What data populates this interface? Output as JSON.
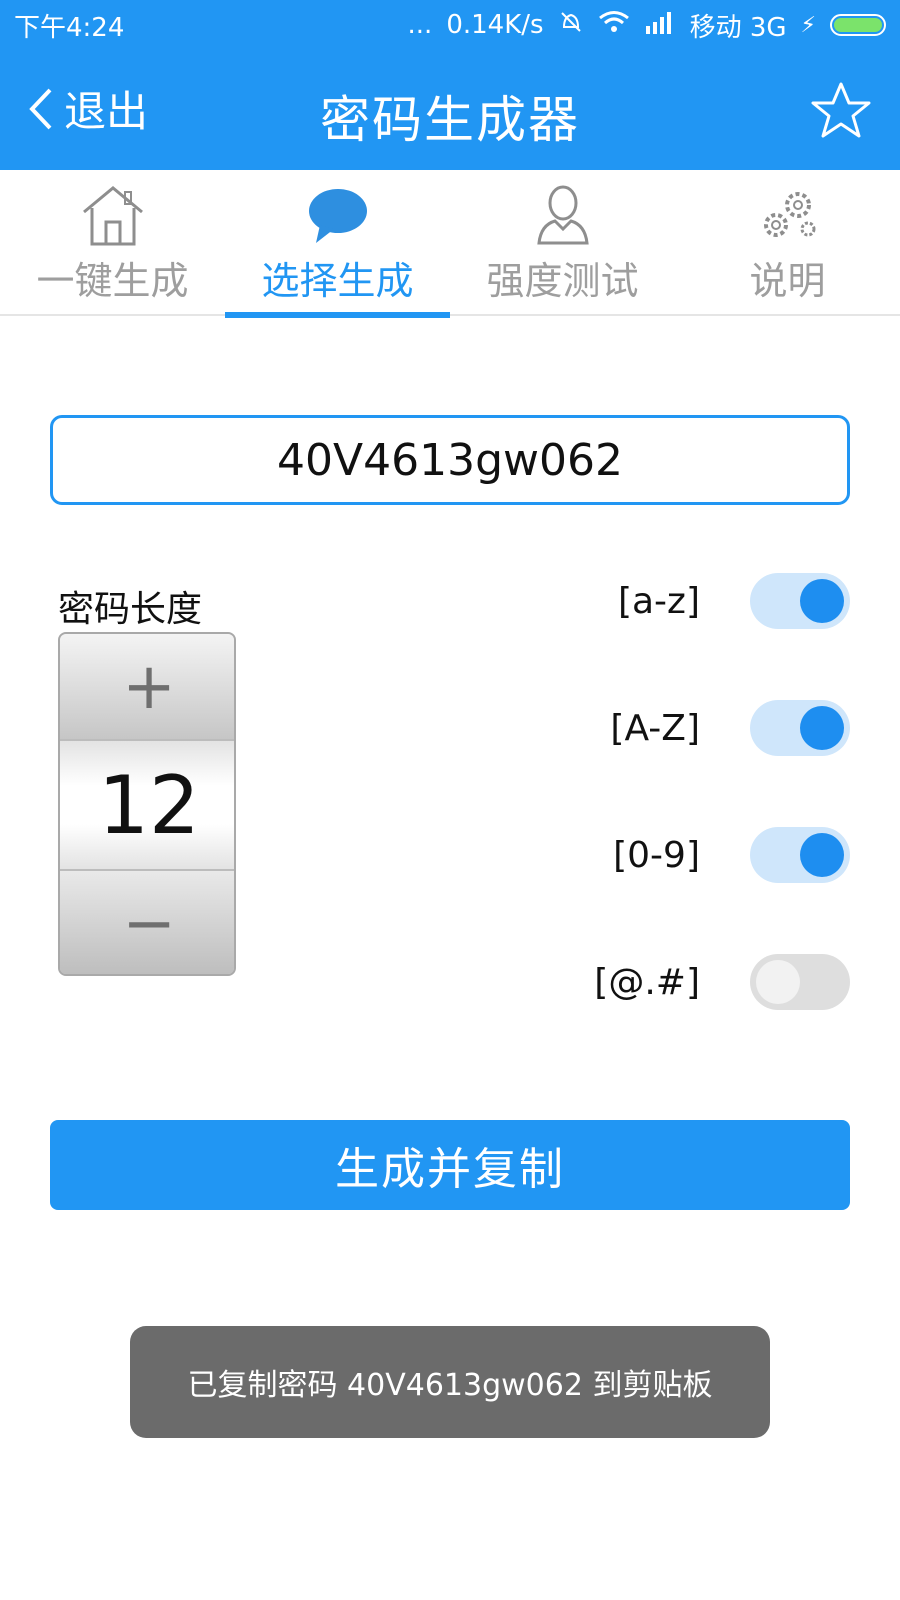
{
  "status_bar": {
    "time": "下午4:24",
    "dots": "...",
    "speed": "0.14K/s",
    "carrier": "移动 3G"
  },
  "app_bar": {
    "back_label": "退出",
    "title": "密码生成器"
  },
  "tabs": [
    {
      "label": "一键生成",
      "icon": "house-icon",
      "active": false
    },
    {
      "label": "选择生成",
      "icon": "speech-bubble-icon",
      "active": true
    },
    {
      "label": "强度测试",
      "icon": "person-icon",
      "active": false
    },
    {
      "label": "说明",
      "icon": "gears-icon",
      "active": false
    }
  ],
  "password": "40V4613gw062",
  "length": {
    "label": "密码长度",
    "value": "12",
    "plus": "+",
    "minus": "−"
  },
  "options": [
    {
      "label": "[a-z]",
      "enabled": true
    },
    {
      "label": "[A-Z]",
      "enabled": true
    },
    {
      "label": "[0-9]",
      "enabled": true
    },
    {
      "label": "[@.#]",
      "enabled": false
    }
  ],
  "generate_button": "生成并复制",
  "toast": "已复制密码 40V4613gw062 到剪贴板",
  "colors": {
    "primary": "#2196f3",
    "toggle_on_track": "#cfe6fb",
    "toggle_off_track": "#dedede",
    "toast_bg": "#6b6b6b"
  }
}
